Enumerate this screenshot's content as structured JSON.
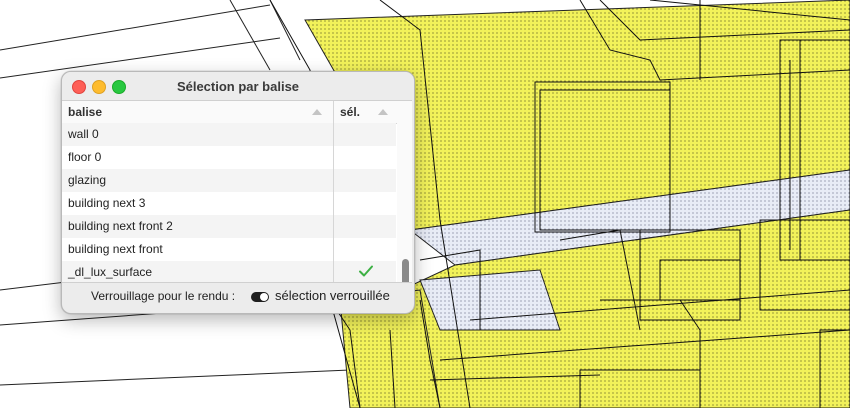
{
  "window": {
    "title": "Sélection par balise"
  },
  "table": {
    "columns": [
      {
        "label": "balise"
      },
      {
        "label": "sél."
      }
    ],
    "rows": [
      {
        "tag": "wall 0",
        "selected": false
      },
      {
        "tag": "floor 0",
        "selected": false
      },
      {
        "tag": "glazing",
        "selected": false
      },
      {
        "tag": "building next 3",
        "selected": false
      },
      {
        "tag": "building next front 2",
        "selected": false
      },
      {
        "tag": "building next front",
        "selected": false
      },
      {
        "tag": "_dl_lux_surface",
        "selected": true
      }
    ]
  },
  "footer": {
    "lock_label": "Verrouillage pour le rendu :",
    "lock_state": "sélection verrouillée",
    "lock_on": true
  },
  "colors": {
    "surface_yellow": "#f2f25a",
    "checkmark": "#3cb043"
  },
  "icons": {
    "check": "checkmark-icon",
    "sort": "sort-arrow-icon"
  }
}
